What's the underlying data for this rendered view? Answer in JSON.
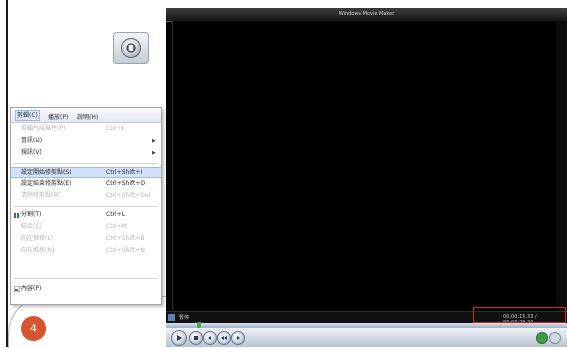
{
  "slide": {
    "number": "4"
  },
  "menu": {
    "bar": [
      {
        "label": "剪輯(C)"
      },
      {
        "label": "播放(P)"
      },
      {
        "label": "說明(H)"
      }
    ],
    "items": [
      {
        "label": "剪輯片段屬性(P)",
        "shortcut": "Ctrl+I",
        "disabled": true
      },
      {
        "label": "音訊(U)",
        "shortcut": "",
        "submenu": true
      },
      {
        "label": "視訊(V)",
        "shortcut": "",
        "submenu": true
      },
      {
        "label": "設定開始修剪點(S)",
        "shortcut": "Ctrl+Shift+I",
        "highlight": true
      },
      {
        "label": "設定結束修剪點(E)",
        "shortcut": "Ctrl+Shift+O"
      },
      {
        "label": "清除修剪點(R)",
        "shortcut": "Ctrl+Shift+Del",
        "disabled": true
      },
      {
        "label": "分割(T)",
        "shortcut": "Ctrl+L",
        "icon": "split-icon"
      },
      {
        "label": "結合(C)",
        "shortcut": "Ctrl+M",
        "disabled": true
      },
      {
        "label": "向左推移(L)",
        "shortcut": "Ctrl+Shift+B",
        "disabled": true
      },
      {
        "label": "向右推移(N)",
        "shortcut": "Ctrl+Shift+N",
        "disabled": true
      },
      {
        "label": "內容(P)",
        "shortcut": "",
        "icon": "properties-icon"
      }
    ]
  },
  "player": {
    "title": "Windows Movie Maker",
    "status_label": "暫停",
    "time": "00:00:15.33 / 00:03:29.20"
  },
  "icons": {
    "logo": "wmp-logo-icon",
    "play": "play-icon",
    "stop": "stop-icon",
    "prev": "previous-icon",
    "next": "next-icon",
    "volume": "volume-icon"
  },
  "colors": {
    "slide_number_bg": "#d9542a",
    "highlight_box": "#e1241a",
    "menu_highlight": "#cfe2f7"
  }
}
